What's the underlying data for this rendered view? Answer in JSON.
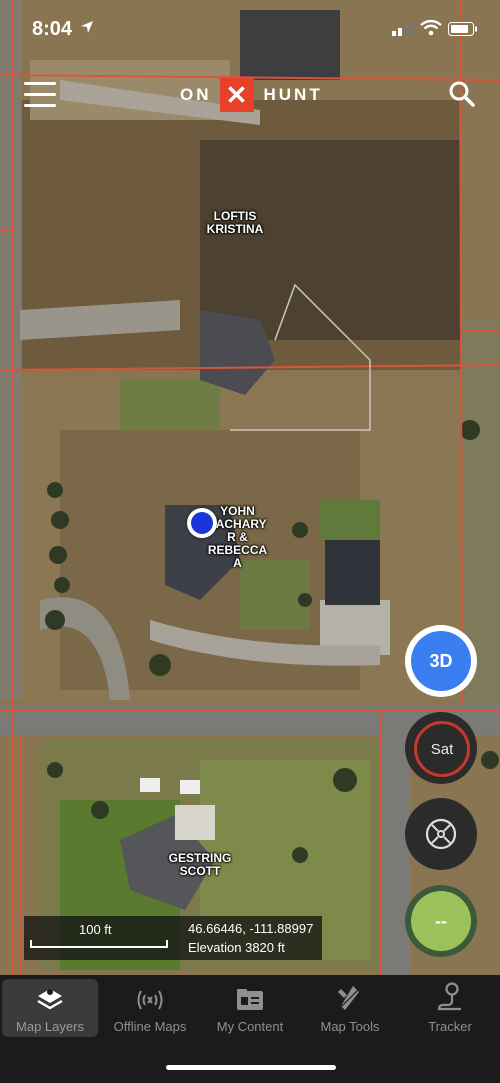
{
  "status_bar": {
    "time": "8:04"
  },
  "header": {
    "logo_left": "ON",
    "logo_mark": "✕",
    "logo_right": "HUNT"
  },
  "owners": [
    {
      "name": "LOFTIS\nKRISTINA"
    },
    {
      "name": "YOHN\nZACHARY\nR &\nREBECCA\nA"
    },
    {
      "name": "GESTRING\nSCOTT"
    }
  ],
  "controls": {
    "view_3d": "3D",
    "basemap": "Sat",
    "tracker_value": "--"
  },
  "info_panel": {
    "scale": "100 ft",
    "coords": "46.66446, -111.88997",
    "elevation": "Elevation 3820 ft"
  },
  "nav": [
    {
      "label": "Map Layers",
      "icon": "map-layers-icon",
      "active": true
    },
    {
      "label": "Offline Maps",
      "icon": "offline-maps-icon"
    },
    {
      "label": "My Content",
      "icon": "my-content-icon"
    },
    {
      "label": "Map Tools",
      "icon": "map-tools-icon"
    },
    {
      "label": "Tracker",
      "icon": "tracker-icon"
    }
  ],
  "colors": {
    "accent": "#e9402a",
    "location_dot": "#1a35d8",
    "button_3d": "#3b7ef1",
    "tracker": "#9bc25a",
    "parcel_line": "#d9553a"
  }
}
